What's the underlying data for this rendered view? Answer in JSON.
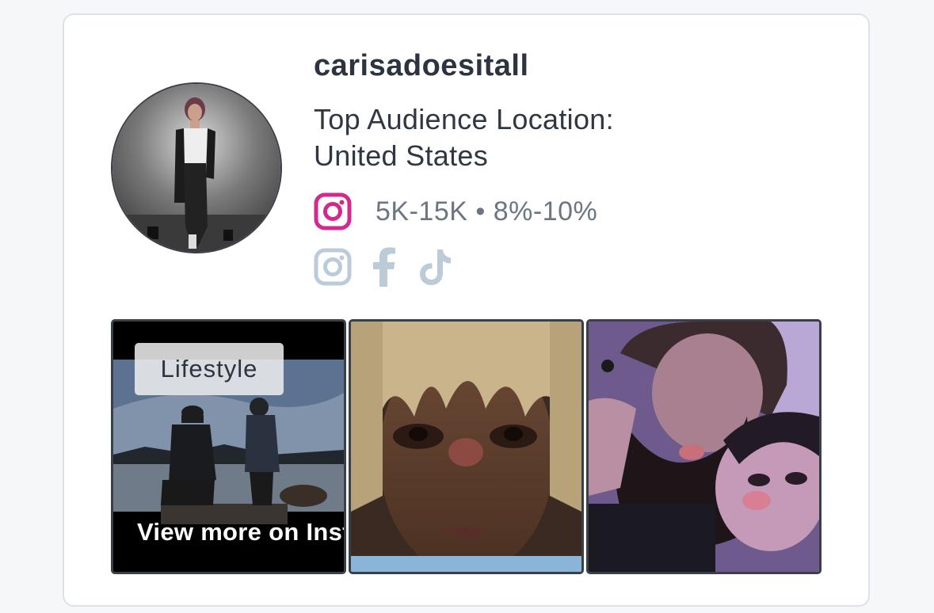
{
  "profile": {
    "username": "carisadoesitall",
    "location_line1": "Top Audience Location:",
    "location_line2": "United States",
    "stats": "5K-15K • 8%-10%"
  },
  "social_icons": [
    "instagram-icon",
    "facebook-icon",
    "tiktok-icon"
  ],
  "posts": {
    "category": "Lifestyle",
    "view_more": "View more on Instagram ↗"
  },
  "colors": {
    "instagram_active": "#d3298f",
    "icon_inactive": "#bccbd8",
    "text_dark": "#2d3440",
    "text_muted": "#6b7684"
  }
}
